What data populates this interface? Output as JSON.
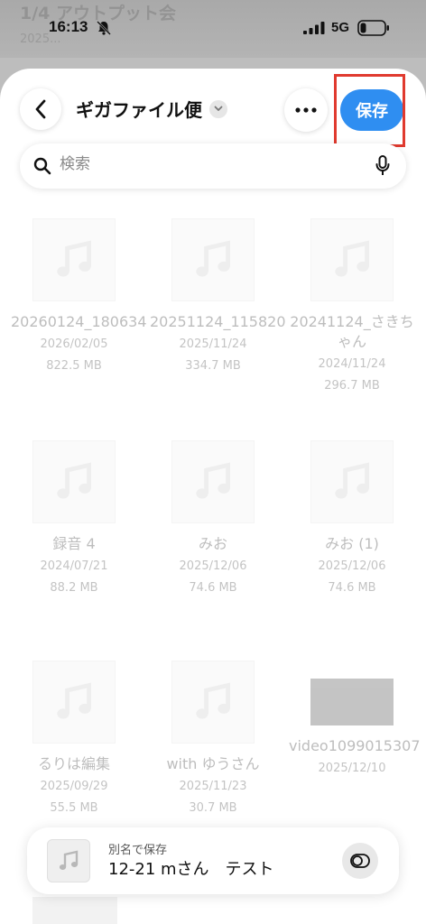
{
  "background": {
    "title": "1/4 アウトプット会",
    "subtitle": "2025..."
  },
  "status": {
    "time": "16:13",
    "network": "5G"
  },
  "header": {
    "folder_title": "ギガファイル便",
    "save_label": "保存"
  },
  "search": {
    "placeholder": "検索"
  },
  "files": [
    {
      "name": "20260124_180634",
      "date": "2026/02/05",
      "size": "822.5 MB",
      "type": "audio"
    },
    {
      "name": "20251124_115820",
      "date": "2025/11/24",
      "size": "334.7 MB",
      "type": "audio"
    },
    {
      "name": "20241124_さきちゃん",
      "date": "2024/11/24",
      "size": "296.7 MB",
      "type": "audio"
    },
    {
      "name": "録音 4",
      "date": "2024/07/21",
      "size": "88.2 MB",
      "type": "audio"
    },
    {
      "name": "みお",
      "date": "2025/12/06",
      "size": "74.6 MB",
      "type": "audio"
    },
    {
      "name": "みお (1)",
      "date": "2025/12/06",
      "size": "74.6 MB",
      "type": "audio"
    },
    {
      "name": "るりは編集",
      "date": "2025/09/29",
      "size": "55.5 MB",
      "type": "audio"
    },
    {
      "name": "with ゆうさん",
      "date": "2025/11/23",
      "size": "30.7 MB",
      "type": "audio"
    },
    {
      "name": "video1099015307",
      "date": "2025/12/10",
      "size": "",
      "type": "video"
    }
  ],
  "save_as": {
    "caption": "別名で保存",
    "value": "12-21 mさん　テスト"
  },
  "colors": {
    "accent": "#2f8ef1",
    "highlight": "#e03a2f"
  }
}
